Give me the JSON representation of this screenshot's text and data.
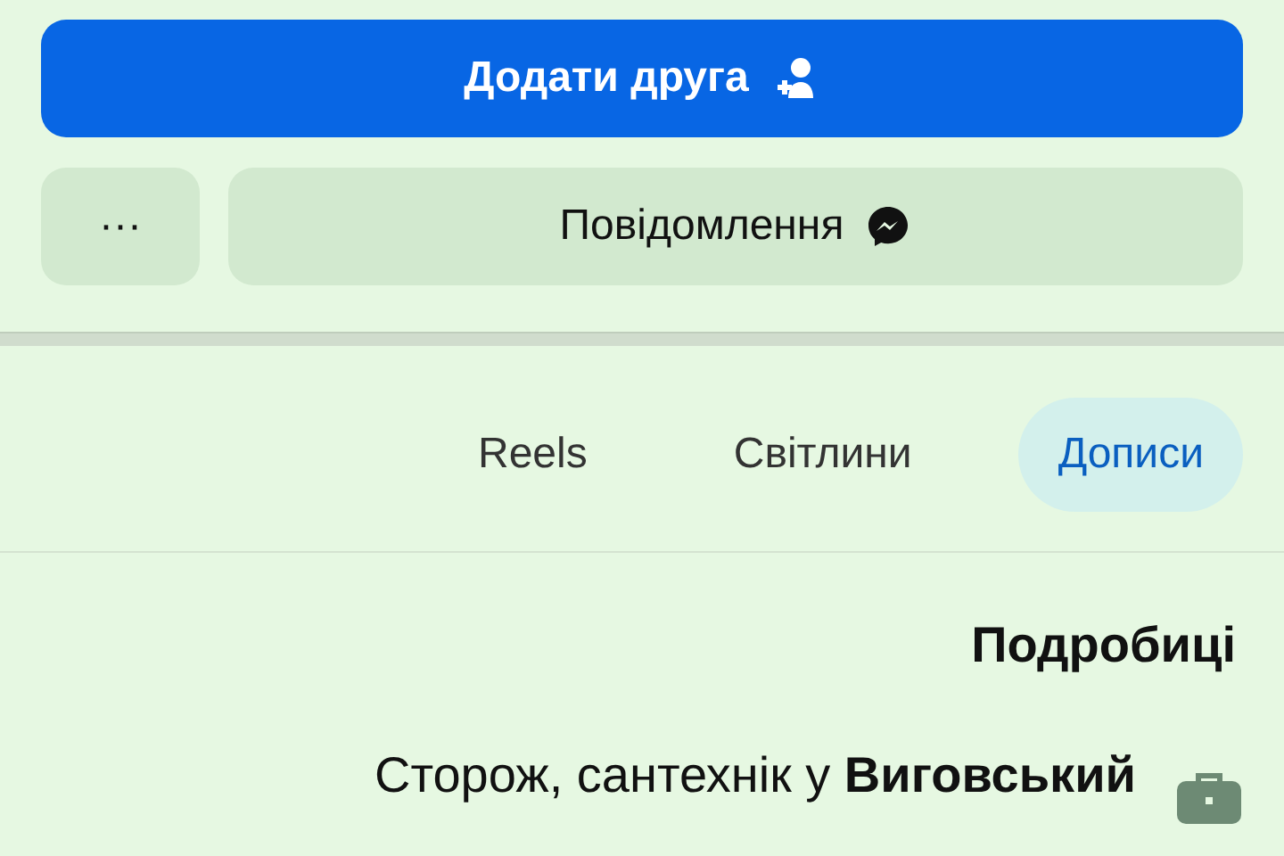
{
  "actions": {
    "primary": {
      "label": "Додати друга"
    },
    "secondary": {
      "label": "Повідомлення"
    },
    "more": {
      "label": "···"
    }
  },
  "tabs": [
    {
      "label": "Reels",
      "selected": false
    },
    {
      "label": "Світлини",
      "selected": false
    },
    {
      "label": "Дописи",
      "selected": true
    }
  ],
  "details": {
    "title": "Подробиці",
    "items": [
      {
        "text": "Сторож, сантехнік у **Виговський**"
      }
    ]
  }
}
